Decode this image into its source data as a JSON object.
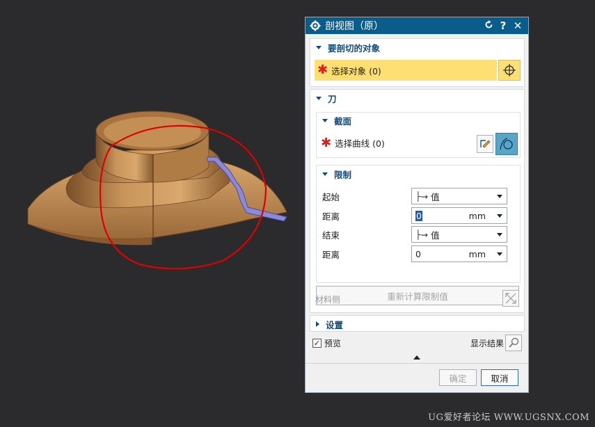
{
  "dialog": {
    "title": "剖视图（原）",
    "title_buttons": {
      "reset_icon": "reset-icon",
      "help": "?",
      "close": "✕"
    },
    "section_objects": {
      "header": "要剖切的对象",
      "select_label": "选择对象 (0)",
      "select_icon": "crosshair-icon"
    },
    "section_knife": {
      "header": "刀",
      "subsection_face": {
        "header": "截面",
        "select_label": "选择曲线 (0)",
        "icons": [
          "sketch-icon",
          "curve-icon"
        ]
      },
      "subsection_limits": {
        "header": "限制",
        "rows": [
          {
            "label": "起始",
            "value": "值",
            "kind": "mode"
          },
          {
            "label": "距离",
            "value": "0",
            "unit": "mm",
            "kind": "distance"
          },
          {
            "label": "结束",
            "value": "值",
            "kind": "mode"
          },
          {
            "label": "距离",
            "value": "0",
            "unit": "mm",
            "kind": "distance"
          }
        ],
        "recalc_button": "重新计算限制值"
      },
      "material_side": "材料侧"
    },
    "section_settings": {
      "header": "设置"
    },
    "preview": {
      "label": "预览",
      "checked": true
    },
    "show_result": "显示结果",
    "ok": "确定",
    "cancel": "取消"
  },
  "watermark": "UG爱好者论坛 WWW.UGSNX.COM",
  "colors": {
    "title_bar": "#0a5c8a",
    "highlight": "#fedf73",
    "required_star": "#e01d1d",
    "part": "#c08a50",
    "annotation": "#e00000"
  }
}
